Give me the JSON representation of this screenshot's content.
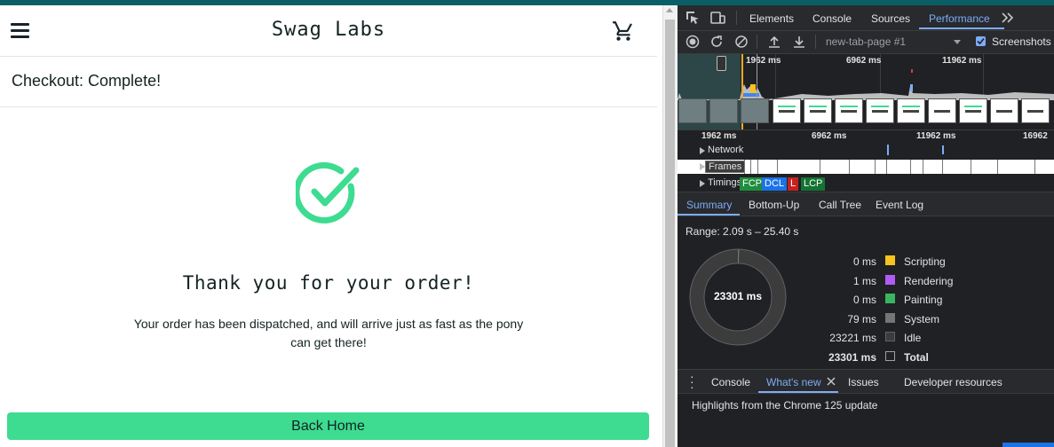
{
  "app": {
    "brand": "Swag Labs",
    "page_title": "Checkout: Complete!",
    "heading": "Thank you for your order!",
    "message": "Your order has been dispatched, and will arrive just as fast as the pony can get there!",
    "back_button": "Back Home",
    "accent_color": "#3ddc91"
  },
  "devtools": {
    "tabs": [
      "Elements",
      "Console",
      "Sources",
      "Performance"
    ],
    "active_tab": "Performance",
    "toolbar": {
      "target": "new-tab-page #1",
      "screenshots_label": "Screenshots",
      "screenshots_checked": true
    },
    "overview_labels": [
      "1962 ms",
      "6962 ms",
      "11962 ms"
    ],
    "ruler_labels": [
      "1962 ms",
      "6962 ms",
      "11962 ms",
      "16962"
    ],
    "tracks": {
      "network": "Network",
      "frames": "Frames",
      "timings": "Timings"
    },
    "timing_markers": [
      {
        "label": "FCP",
        "color": "#1e8e3e"
      },
      {
        "label": "DCL",
        "color": "#1a73e8"
      },
      {
        "label": "L",
        "color": "#c5221f"
      },
      {
        "label": "LCP",
        "color": "#137333"
      }
    ],
    "sub_tabs": [
      "Summary",
      "Bottom-Up",
      "Call Tree",
      "Event Log"
    ],
    "active_sub_tab": "Summary",
    "summary": {
      "range": "Range: 2.09 s – 25.40 s",
      "total_label": "23301 ms",
      "rows": [
        {
          "value": "0 ms",
          "name": "Scripting",
          "color": "#f9c31d"
        },
        {
          "value": "1 ms",
          "name": "Rendering",
          "color": "#af5cf7"
        },
        {
          "value": "0 ms",
          "name": "Painting",
          "color": "#3bb45f"
        },
        {
          "value": "79 ms",
          "name": "System",
          "color": "#757575"
        },
        {
          "value": "23221 ms",
          "name": "Idle",
          "color": "#3c3c3c"
        },
        {
          "value": "23301 ms",
          "name": "Total",
          "color": "#202124"
        }
      ]
    },
    "drawer_tabs": [
      "Console",
      "What's new",
      "Issues",
      "Developer resources"
    ],
    "active_drawer_tab": "What's new",
    "highlights": "Highlights from the Chrome 125 update"
  }
}
